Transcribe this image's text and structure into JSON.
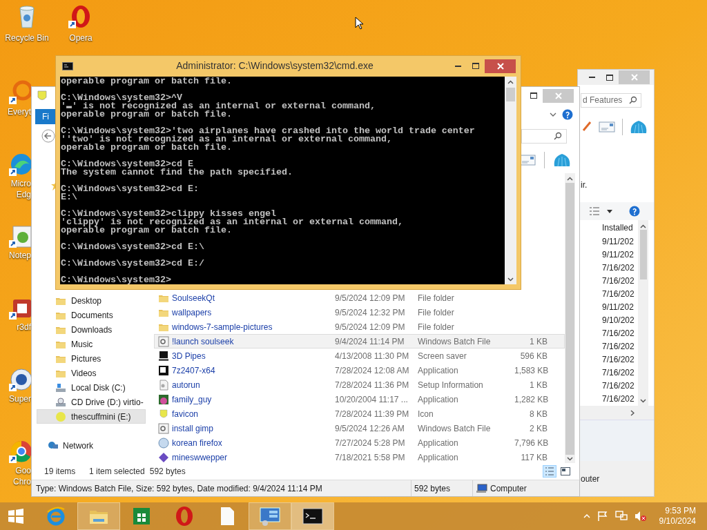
{
  "desktop": {
    "top_icons": [
      {
        "kind": "recycle",
        "lines": [
          "Recycle Bin"
        ]
      },
      {
        "kind": "opera",
        "lines": [
          "Opera"
        ]
      }
    ],
    "side_icons": [
      {
        "kind": "everything",
        "lines": [
          "Everyt"
        ]
      },
      {
        "kind": "edge",
        "lines": [
          "Micro",
          "Edg"
        ]
      },
      {
        "kind": "notepad",
        "lines": [
          "Notep"
        ]
      },
      {
        "kind": "generic",
        "lines": [
          "r3df"
        ]
      },
      {
        "kind": "super",
        "lines": [
          "Super"
        ]
      },
      {
        "kind": "chrome",
        "lines": [
          "Goo",
          "Chro"
        ]
      }
    ]
  },
  "programs_window": {
    "search_placeholder": "d Features",
    "text_fragment": "ir.",
    "column_header": "Installed",
    "dates": [
      "9/11/202",
      "9/11/202",
      "7/16/202",
      "7/16/202",
      "7/16/202",
      "9/11/202",
      "9/10/202",
      "7/16/202",
      "7/16/202",
      "7/16/202",
      "7/16/202",
      "7/16/202",
      "7/16/202"
    ],
    "status_fragment": "outer"
  },
  "explorer": {
    "ribbon_tab": "Fi",
    "nav_items": [
      {
        "label": "Desktop",
        "kind": "folder",
        "selected": false
      },
      {
        "label": "Documents",
        "kind": "folder",
        "selected": false
      },
      {
        "label": "Downloads",
        "kind": "folder",
        "selected": false
      },
      {
        "label": "Music",
        "kind": "folder",
        "selected": false
      },
      {
        "label": "Pictures",
        "kind": "folder",
        "selected": false
      },
      {
        "label": "Videos",
        "kind": "folder",
        "selected": false
      },
      {
        "label": "Local Disk (C:)",
        "kind": "disk",
        "selected": false
      },
      {
        "label": "CD Drive (D:) virtio-",
        "kind": "cd",
        "selected": false
      },
      {
        "label": "thescuffmini (E:)",
        "kind": "usb",
        "selected": true
      }
    ],
    "network_item": {
      "label": "Network"
    },
    "files": [
      {
        "name": "SoulseekQt",
        "date": "9/5/2024 12:09 PM",
        "type": "File folder",
        "kind": "folder",
        "selected": false
      },
      {
        "name": "wallpapers",
        "date": "9/5/2024 12:32 PM",
        "type": "File folder",
        "kind": "folder",
        "selected": false
      },
      {
        "name": "windows-7-sample-pictures",
        "date": "9/5/2024 12:09 PM",
        "type": "File folder",
        "kind": "folder",
        "selected": false
      },
      {
        "name": "!launch soulseek",
        "date": "9/4/2024 11:14 PM",
        "type": "Windows Batch File",
        "size": "1 KB",
        "kind": "batch",
        "selected": true
      },
      {
        "name": "3D Pipes",
        "date": "4/13/2008 11:30 PM",
        "type": "Screen saver",
        "size": "596 KB",
        "kind": "screen",
        "selected": false
      },
      {
        "name": "7z2407-x64",
        "date": "7/28/2024 12:08 AM",
        "type": "Application",
        "size": "1,583 KB",
        "kind": "archive",
        "selected": false
      },
      {
        "name": "autorun",
        "date": "7/28/2024 11:36 PM",
        "type": "Setup Information",
        "size": "1 KB",
        "kind": "setup",
        "selected": false
      },
      {
        "name": "family_guy",
        "date": "10/20/2004 11:17 ...",
        "type": "Application",
        "size": "1,282 KB",
        "kind": "app",
        "selected": false
      },
      {
        "name": "favicon",
        "date": "7/28/2024 11:39 PM",
        "type": "Icon",
        "size": "8 KB",
        "kind": "icon",
        "selected": false
      },
      {
        "name": "install gimp",
        "date": "9/5/2024 12:26 AM",
        "type": "Windows Batch File",
        "size": "2 KB",
        "kind": "batch",
        "selected": false
      },
      {
        "name": "korean firefox",
        "date": "7/27/2024 5:28 PM",
        "type": "Application",
        "size": "7,796 KB",
        "kind": "globe",
        "selected": false
      },
      {
        "name": "mineswwepper",
        "date": "7/18/2021 5:58 PM",
        "type": "Application",
        "size": "117 KB",
        "kind": "gem",
        "selected": false
      }
    ],
    "status": {
      "count": "19 items",
      "selection": "1 item selected",
      "size": "592 bytes"
    },
    "view_buttons": [
      {
        "kind": "details",
        "selected": true
      },
      {
        "kind": "preview",
        "selected": false
      }
    ],
    "details_bar": {
      "description": "Type: Windows Batch File, Size: 592 bytes, Date modified: 9/4/2024 11:14 PM",
      "size": "592 bytes",
      "location": "Computer"
    }
  },
  "cmd_window": {
    "title": "Administrator: C:\\Windows\\system32\\cmd.exe",
    "console_blocks": [
      [
        "operable program or batch file."
      ],
      [
        "C:\\Windows\\system32>^V",
        "'▬' is not recognized as an internal or external command,",
        "operable program or batch file."
      ],
      [
        "C:\\Windows\\system32>'two airplanes have crashed into the world trade center",
        "''two' is not recognized as an internal or external command,",
        "operable program or batch file."
      ],
      [
        "C:\\Windows\\system32>cd E",
        "The system cannot find the path specified."
      ],
      [
        "C:\\Windows\\system32>cd E:",
        "E:\\"
      ],
      [
        "C:\\Windows\\system32>clippy kisses engel",
        "'clippy' is not recognized as an internal or external command,",
        "operable program or batch file."
      ],
      [
        "C:\\Windows\\system32>cd E:\\"
      ],
      [
        "C:\\Windows\\system32>cd E:/"
      ],
      [
        "C:\\Windows\\system32>"
      ]
    ]
  },
  "taskbar": {
    "apps": [
      {
        "kind": "ie",
        "running": false,
        "active": false
      },
      {
        "kind": "explorer",
        "running": true,
        "active": false
      },
      {
        "kind": "store",
        "running": false,
        "active": false
      },
      {
        "kind": "opera",
        "running": false,
        "active": false
      },
      {
        "kind": "file",
        "running": false,
        "active": false
      },
      {
        "kind": "control",
        "running": true,
        "active": false
      },
      {
        "kind": "cmd",
        "running": true,
        "active": true
      }
    ],
    "clock": {
      "time": "9:53 PM",
      "date": "9/10/2024"
    }
  }
}
